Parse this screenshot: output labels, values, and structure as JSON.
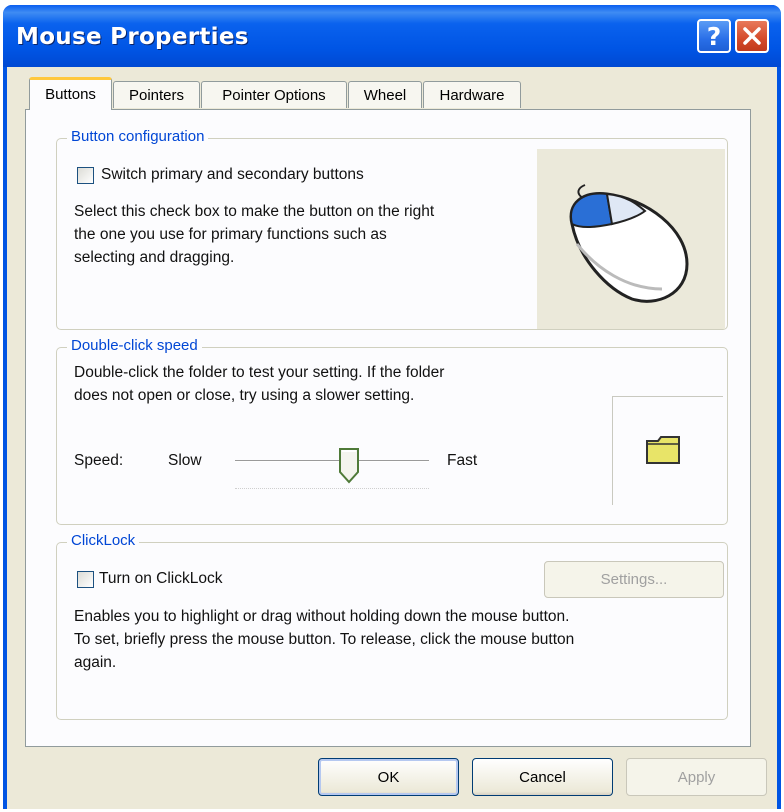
{
  "window": {
    "title": "Mouse Properties",
    "help_glyph": "?"
  },
  "tabs": [
    {
      "label": "Buttons",
      "active": true
    },
    {
      "label": "Pointers",
      "active": false
    },
    {
      "label": "Pointer Options",
      "active": false
    },
    {
      "label": "Wheel",
      "active": false
    },
    {
      "label": "Hardware",
      "active": false
    }
  ],
  "button_configuration": {
    "legend": "Button configuration",
    "checkbox_label": "Switch primary and secondary buttons",
    "checked": false,
    "description_lines": [
      "Select this check box to make the button on the right",
      "the one you use for primary functions such as",
      "selecting and dragging."
    ],
    "mouse_image_icon": "mouse-icon"
  },
  "double_click_speed": {
    "legend": "Double-click speed",
    "description_lines": [
      "Double-click the folder to test your setting. If the folder",
      "does not open or close, try using a slower setting."
    ],
    "speed_label": "Speed:",
    "slow_label": "Slow",
    "fast_label": "Fast",
    "slider_value": 0.6,
    "test_folder_icon": "folder-icon"
  },
  "clicklock": {
    "legend": "ClickLock",
    "checkbox_label": "Turn on ClickLock",
    "checked": false,
    "settings_button": "Settings...",
    "description_lines": [
      "Enables you to highlight or drag without holding down the mouse button.",
      "To set, briefly press the mouse button. To release, click the mouse button",
      "again."
    ]
  },
  "footer": {
    "ok": "OK",
    "cancel": "Cancel",
    "apply": "Apply"
  },
  "colors": {
    "titlebar": "#0054e3",
    "legend_text": "#0046d5",
    "active_tab_accent": "#ffc83c",
    "close_button": "#d44a2a"
  }
}
